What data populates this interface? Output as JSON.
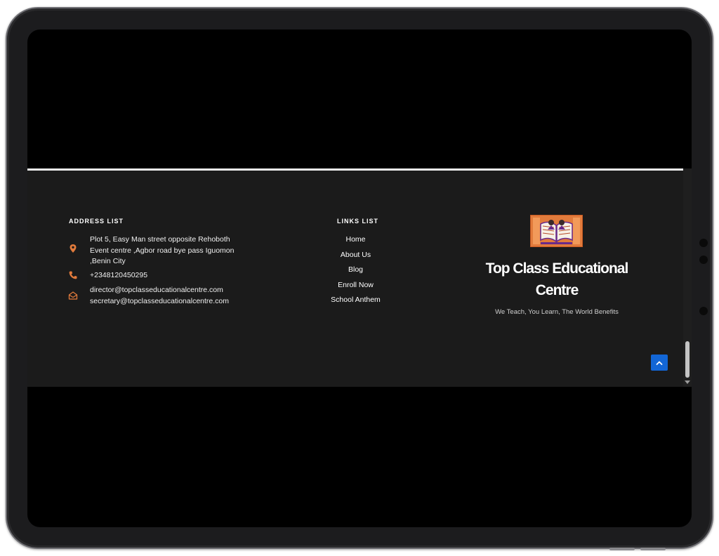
{
  "footer": {
    "address": {
      "heading": "ADDRESS LIST",
      "location_lines": [
        "Plot 5, Easy Man street opposite Rehoboth",
        "Event centre ,Agbor road bye pass Iguomon",
        ",Benin City"
      ],
      "phone": "+2348120450295",
      "emails": [
        "director@topclasseducationalcentre.com",
        "secretary@topclasseducationalcentre.com"
      ]
    },
    "links": {
      "heading": "LINKS LIST",
      "items": [
        "Home",
        "About Us",
        "Blog",
        "Enroll Now",
        "School Anthem"
      ]
    },
    "brand": {
      "name_line1": "Top Class Educational",
      "name_line2": "Centre",
      "tagline": "We Teach, You Learn, The World Benefits"
    }
  },
  "colors": {
    "accent": "#e27b3c",
    "footer_bg": "#1b1b1b",
    "scroll_top_button": "#1266d6"
  },
  "icons": {
    "location": "map-pin-icon",
    "phone": "phone-icon",
    "email": "envelope-open-icon",
    "scroll_top": "chevron-up-icon",
    "logo": "book-logo"
  }
}
